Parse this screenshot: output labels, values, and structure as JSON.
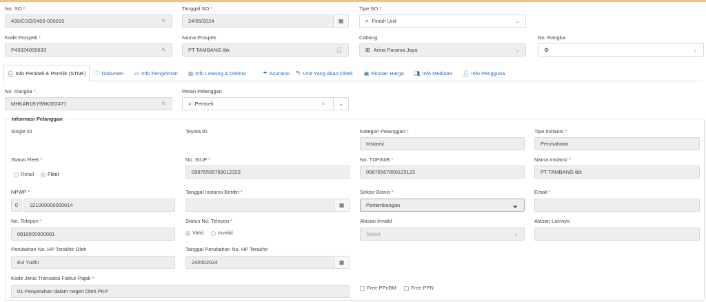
{
  "colors": {
    "accent": "#2d6db5",
    "required": "#d9534f",
    "top_bar": "#f0c27a"
  },
  "header": {
    "no_so": {
      "label": "No. SO",
      "value": "430/CSO/2405-000019"
    },
    "tanggal_so": {
      "label": "Tanggal SO",
      "value": "24/05/2024"
    },
    "tipe_so": {
      "label": "Tipe SO",
      "value": "Finish Unit"
    },
    "kode_prospek": {
      "label": "Kode Prospek",
      "value": "P43024000633"
    },
    "nama_prospek": {
      "label": "Nama Prospek",
      "value": "PT TAMBANG tbk"
    },
    "cabang": {
      "label": "Cabang",
      "value": "Arina Parama Jaya"
    },
    "no_rangka": {
      "label": "No. Rangka",
      "value": ""
    }
  },
  "tabs": [
    {
      "label": "Info Pembeli & Pemilik (STNK)",
      "icon": "user-icon"
    },
    {
      "label": "Dokumen",
      "icon": "folder-icon"
    },
    {
      "label": "Info Pengiriman",
      "icon": "truck-icon"
    },
    {
      "label": "Info Leasing & Debitur",
      "icon": "money-icon"
    },
    {
      "label": "Asuransi",
      "icon": "umbrella-icon"
    },
    {
      "label": "Unit Yang Akan Dibeli",
      "icon": "car-icon"
    },
    {
      "label": "Rincian Harga",
      "icon": "tag-icon"
    },
    {
      "label": "Info Mediator",
      "icon": "users-icon"
    },
    {
      "label": "Info Pengguna",
      "icon": "user-icon"
    }
  ],
  "buyer": {
    "no_rangka": {
      "label": "No. Rangka",
      "value": "MHKAB1BY9RK082471"
    },
    "peran_pelanggan": {
      "label": "Peran Pelanggan",
      "value": "Pembeli"
    }
  },
  "info": {
    "legend": "Informasi Pelanggan",
    "single_id": {
      "label": "Single ID"
    },
    "toyota_id": {
      "label": "Toyota ID"
    },
    "kategori": {
      "label": "Kategori Pelanggan",
      "value": "Instansi"
    },
    "tipe_instansi": {
      "label": "Tipe Instansi",
      "value": "Perusahaan"
    },
    "status_fleet": {
      "label": "Status Fleet",
      "opt1": "Retail",
      "opt2": "Fleet"
    },
    "no_siup": {
      "label": "No. SIUP",
      "value": "09876556789012323"
    },
    "no_tdp": {
      "label": "No. TDP/NIB",
      "value": "09876567890123123"
    },
    "nama_instansi": {
      "label": "Nama Instansi",
      "value": "PT TAMBANG tbk"
    },
    "npwp": {
      "label": "NPWP",
      "prefix": "0",
      "value": "321000000000014"
    },
    "tgl_instansi": {
      "label": "Tanggal Instansi Berdiri",
      "value": ""
    },
    "sektor": {
      "label": "Sektor Bisnis",
      "value": "Pertambangan"
    },
    "email": {
      "label": "Email",
      "value": ""
    },
    "no_telepon": {
      "label": "No. Telepon",
      "value": "0810000000001"
    },
    "status_telepon": {
      "label": "Status No. Telepon",
      "opt1": "Valid",
      "opt2": "Invalid"
    },
    "alasan_invalid": {
      "label": "Alasan Invalid",
      "placeholder": "Select"
    },
    "alasan_lainnya": {
      "label": "Alasan Lainnya",
      "value": ""
    },
    "perubahan_oleh": {
      "label": "Perubahan No. HP Terakhir Oleh",
      "value": "Evi Yudhi"
    },
    "tgl_perubahan": {
      "label": "Tanggal Perubahan No. HP Terakhir",
      "value": "24/05/2024"
    },
    "kode_faktur": {
      "label": "Kode Jenis Transaksi Faktur Pajak",
      "value": "01-Penyerahan dalam negeri Oleh PKP"
    },
    "free_ppnbm": "Free PPnBM",
    "free_ppn": "Free PPN"
  }
}
